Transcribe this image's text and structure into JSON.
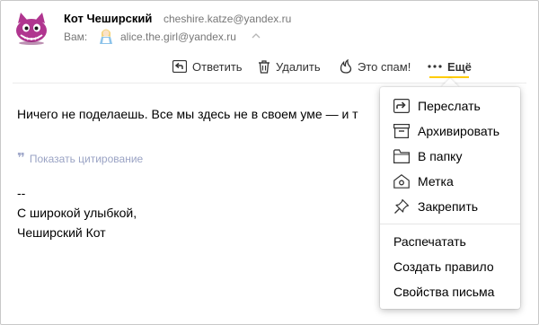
{
  "header": {
    "sender_name": "Кот Чеширский",
    "sender_email": "cheshire.katze@yandex.ru",
    "to_label": "Вам:",
    "to_email": "alice.the.girl@yandex.ru"
  },
  "toolbar": {
    "reply_label": "Ответить",
    "delete_label": "Удалить",
    "spam_label": "Это спам!",
    "more_label": "Ещё",
    "accent_color": "#ffcc00"
  },
  "message": {
    "text": "Ничего не поделаешь. Все мы здесь не в своем уме — и т",
    "show_quote_label": "Показать цитирование",
    "signature": [
      "--",
      "С широкой улыбкой,",
      "Чеширский Кот"
    ]
  },
  "dropdown": {
    "icon_items": [
      {
        "label": "Переслать",
        "icon": "forward-icon"
      },
      {
        "label": "Архивировать",
        "icon": "archive-icon"
      },
      {
        "label": "В папку",
        "icon": "folder-icon"
      },
      {
        "label": "Метка",
        "icon": "label-icon"
      },
      {
        "label": "Закрепить",
        "icon": "pin-icon"
      }
    ],
    "plain_items": [
      {
        "label": "Распечатать"
      },
      {
        "label": "Создать правило"
      },
      {
        "label": "Свойства письма"
      }
    ]
  }
}
